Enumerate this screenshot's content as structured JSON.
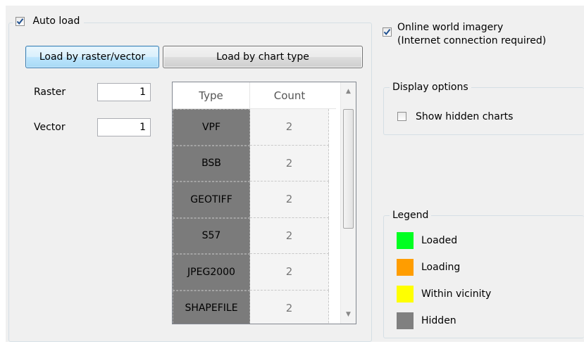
{
  "auto_load": {
    "label": "Auto load",
    "checked": true
  },
  "buttons": {
    "load_by_raster_vector": "Load by raster/vector",
    "load_by_chart_type": "Load by chart type"
  },
  "fields": {
    "raster": {
      "label": "Raster",
      "value": "1"
    },
    "vector": {
      "label": "Vector",
      "value": "1"
    }
  },
  "table": {
    "headers": {
      "type": "Type",
      "count": "Count"
    },
    "rows": [
      {
        "type": "VPF",
        "count": "2"
      },
      {
        "type": "BSB",
        "count": "2"
      },
      {
        "type": "GEOTIFF",
        "count": "2"
      },
      {
        "type": "S57",
        "count": "2"
      },
      {
        "type": "JPEG2000",
        "count": "2"
      },
      {
        "type": "SHAPEFILE",
        "count": "2"
      }
    ]
  },
  "online_imagery": {
    "line1": "Online world imagery",
    "line2": "(Internet connection required)",
    "checked": true
  },
  "display_options": {
    "title": "Display options",
    "show_hidden_charts": {
      "label": "Show hidden charts",
      "checked": false
    }
  },
  "legend": {
    "title": "Legend",
    "items": [
      {
        "label": "Loaded",
        "color": "#00ff21"
      },
      {
        "label": "Loading",
        "color": "#ff9d00"
      },
      {
        "label": "Within vicinity",
        "color": "#ffff00"
      },
      {
        "label": "Hidden",
        "color": "#808080"
      }
    ]
  },
  "colors": {
    "accent_check": "#1e4f8f",
    "active_button_border": "#3c7fb1"
  }
}
